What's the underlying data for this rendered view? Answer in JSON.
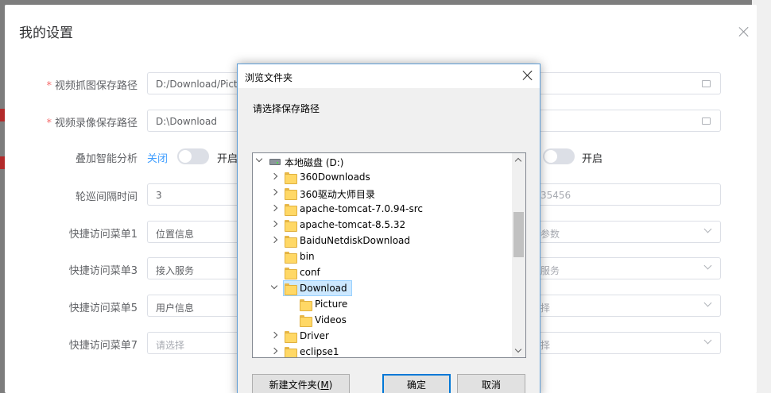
{
  "settings_dialog": {
    "title": "我的设置",
    "rows": [
      {
        "required": true,
        "label": "视频抓图保存路径",
        "left_value": "D:/Download/Pictur",
        "right_value": "",
        "control": "path"
      },
      {
        "required": true,
        "label": "视频录像保存路径",
        "left_value": "D:\\Download",
        "right_value": "",
        "control": "path"
      },
      {
        "required": false,
        "label": "叠加智能分析",
        "off_label": "关闭",
        "on_label": "开启",
        "right_on_label": "开启",
        "control": "switch"
      },
      {
        "required": false,
        "label": "轮巡间隔时间",
        "left_value": "3",
        "right_value": "35456",
        "control": "text"
      },
      {
        "required": false,
        "label": "快捷访问菜单1",
        "left_value": "位置信息",
        "right_value": "参数",
        "control": "select"
      },
      {
        "required": false,
        "label": "快捷访问菜单3",
        "left_value": "接入服务",
        "right_value": "服务",
        "control": "select"
      },
      {
        "required": false,
        "label": "快捷访问菜单5",
        "left_value": "用户信息",
        "right_value": "择",
        "control": "select"
      },
      {
        "required": false,
        "label": "快捷访问菜单7",
        "left_value": "请选择",
        "right_value": "择",
        "control": "select",
        "placeholder": true
      }
    ]
  },
  "browse_dialog": {
    "title": "浏览文件夹",
    "prompt": "请选择保存路径",
    "tree": [
      {
        "label": "本地磁盘 (D:)",
        "level": 0,
        "expander": "open",
        "kind": "drive"
      },
      {
        "label": "360Downloads",
        "level": 1,
        "expander": "closed",
        "kind": "folder"
      },
      {
        "label": "360驱动大师目录",
        "level": 1,
        "expander": "closed",
        "kind": "folder"
      },
      {
        "label": "apache-tomcat-7.0.94-src",
        "level": 1,
        "expander": "closed",
        "kind": "folder"
      },
      {
        "label": "apache-tomcat-8.5.32",
        "level": 1,
        "expander": "closed",
        "kind": "folder"
      },
      {
        "label": "BaiduNetdiskDownload",
        "level": 1,
        "expander": "closed",
        "kind": "folder"
      },
      {
        "label": "bin",
        "level": 1,
        "expander": "none",
        "kind": "folder"
      },
      {
        "label": "conf",
        "level": 1,
        "expander": "none",
        "kind": "folder"
      },
      {
        "label": "Download",
        "level": 1,
        "expander": "open",
        "kind": "folder",
        "selected": true
      },
      {
        "label": "Picture",
        "level": 2,
        "expander": "none",
        "kind": "folder"
      },
      {
        "label": "Videos",
        "level": 2,
        "expander": "none",
        "kind": "folder"
      },
      {
        "label": "Driver",
        "level": 1,
        "expander": "closed",
        "kind": "folder"
      },
      {
        "label": "eclipse1",
        "level": 1,
        "expander": "closed",
        "kind": "folder"
      }
    ],
    "buttons": {
      "new_folder": "新建文件夹(",
      "new_folder_key": "M",
      "new_folder_end": ")",
      "ok": "确定",
      "cancel": "取消"
    }
  }
}
